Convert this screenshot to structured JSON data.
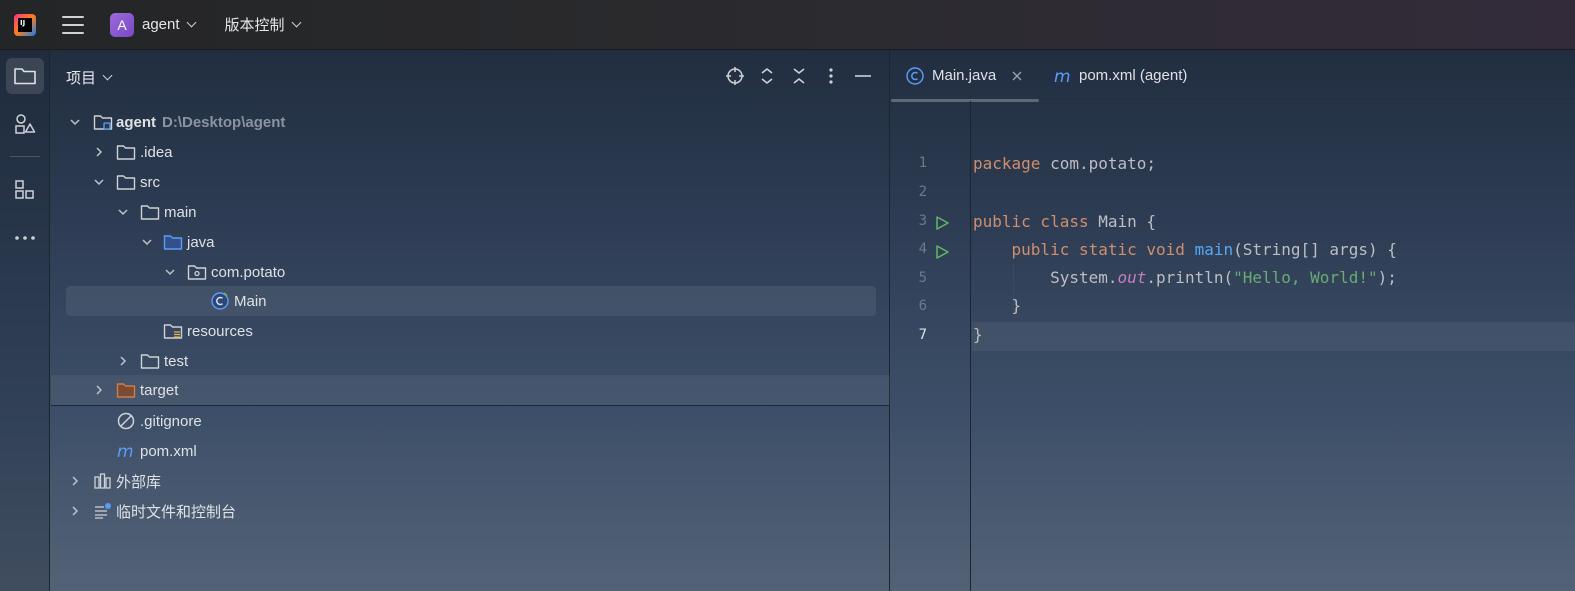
{
  "titlebar": {
    "logo_text": "IJ",
    "project_badge": "A",
    "project_name": "agent",
    "vcs_label": "版本控制"
  },
  "project_panel": {
    "title": "项目",
    "tree": [
      {
        "label": "agent",
        "hint": "D:\\Desktop\\agent",
        "icon": "module-folder-icon",
        "expanded": true
      },
      {
        "label": ".idea",
        "icon": "folder-icon",
        "expanded": false
      },
      {
        "label": "src",
        "icon": "folder-icon",
        "expanded": true
      },
      {
        "label": "main",
        "icon": "folder-icon",
        "expanded": true
      },
      {
        "label": "java",
        "icon": "source-folder-icon",
        "expanded": true
      },
      {
        "label": "com.potato",
        "icon": "package-icon",
        "expanded": true
      },
      {
        "label": "Main",
        "icon": "java-class-icon",
        "selected": true
      },
      {
        "label": "resources",
        "icon": "resources-folder-icon"
      },
      {
        "label": "test",
        "icon": "folder-icon",
        "expanded": false
      },
      {
        "label": "target",
        "icon": "excluded-folder-icon",
        "expanded": false
      },
      {
        "label": ".gitignore",
        "icon": "ignored-file-icon"
      },
      {
        "label": "pom.xml",
        "icon": "maven-icon"
      },
      {
        "label": "外部库",
        "icon": "library-icon",
        "expanded": false
      },
      {
        "label": "临时文件和控制台",
        "icon": "scratches-icon",
        "expanded": false
      }
    ]
  },
  "editor": {
    "tabs": [
      {
        "label": "Main.java",
        "active": true
      },
      {
        "label": "pom.xml (agent)",
        "active": false
      }
    ],
    "line_numbers": [
      "1",
      "2",
      "3",
      "4",
      "5",
      "6",
      "7"
    ],
    "code": {
      "l1_kw": "package",
      "l1_rest": " com.potato;",
      "l3_kw": "public class",
      "l3_rest": " Main {",
      "l4_kw": "public static void",
      "l4_fn": "main",
      "l4_rest": "(String[] args) {",
      "l5_a": "System.",
      "l5_out": "out",
      "l5_b": ".println(",
      "l5_str": "\"Hello, World!\"",
      "l5_c": ");",
      "l6": "}",
      "l7": "}"
    }
  },
  "colors": {
    "keyword": "#cf8e6d",
    "function": "#56a8f5",
    "string": "#6aab73",
    "static_field": "#c77dbb"
  }
}
